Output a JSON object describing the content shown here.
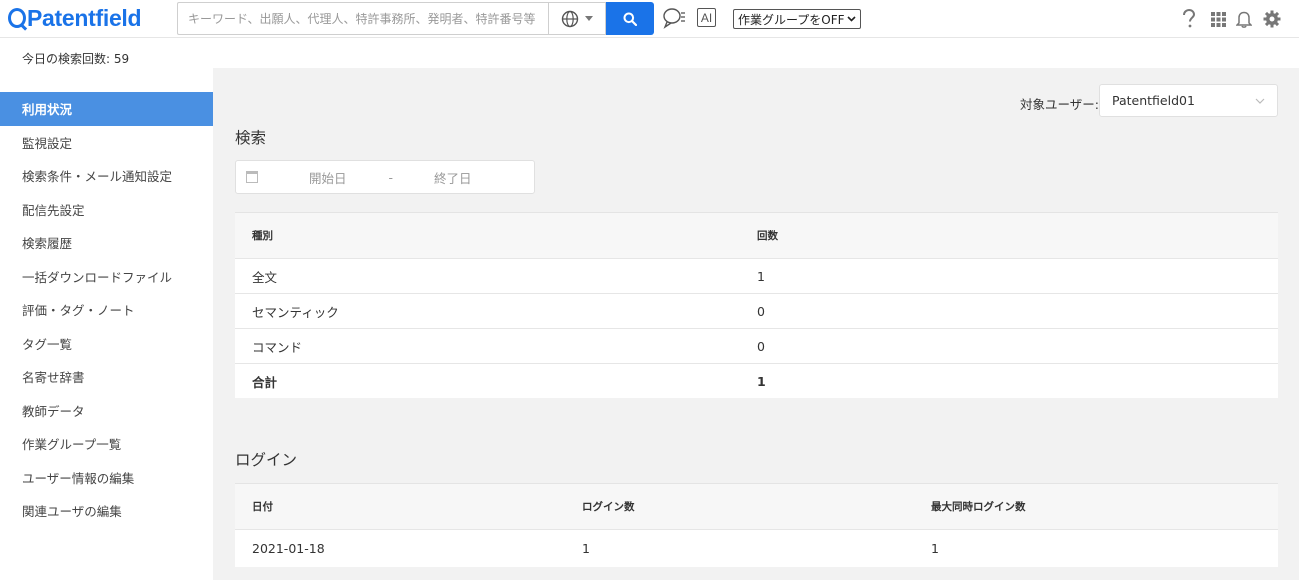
{
  "header": {
    "logo": "Patentfield",
    "search_placeholder": "キーワード、出願人、代理人、特許事務所、発明者、特許番号等",
    "work_group": "作業グループをOFF",
    "ai_label": "AI"
  },
  "sidebar": {
    "search_count": "今日の検索回数: 59",
    "items": [
      {
        "label": "利用状況",
        "active": true
      },
      {
        "label": "監視設定"
      },
      {
        "label": "検索条件・メール通知設定"
      },
      {
        "label": "配信先設定"
      },
      {
        "label": "検索履歴"
      },
      {
        "label": "一括ダウンロードファイル"
      },
      {
        "label": "評価・タグ・ノート"
      },
      {
        "label": "タグ一覧"
      },
      {
        "label": "名寄せ辞書"
      },
      {
        "label": "教師データ"
      },
      {
        "label": "作業グループ一覧"
      },
      {
        "label": "ユーザー情報の編集"
      },
      {
        "label": "関連ユーザの編集"
      }
    ]
  },
  "main": {
    "target_user_label": "対象ユーザー:",
    "target_user_value": "Patentfield01",
    "search_section": {
      "title": "検索",
      "date_start_placeholder": "開始日",
      "date_separator": "-",
      "date_end_placeholder": "終了日",
      "columns": [
        "種別",
        "回数"
      ],
      "rows": [
        [
          "全文",
          "1"
        ],
        [
          "セマンティック",
          "0"
        ],
        [
          "コマンド",
          "0"
        ]
      ],
      "total": [
        "合計",
        "1"
      ]
    },
    "login_section": {
      "title": "ログイン",
      "columns": [
        "日付",
        "ログイン数",
        "最大同時ログイン数"
      ],
      "rows": [
        [
          "2021-01-18",
          "1",
          "1"
        ]
      ]
    }
  },
  "colors": {
    "brand": "#1a73e8",
    "active_nav": "#4a90e2",
    "main_bg": "#f2f2f2"
  },
  "icons": [
    "globe-icon",
    "search-icon",
    "chat-icon",
    "ai-icon",
    "help-icon",
    "apps-grid-icon",
    "bell-icon",
    "gear-icon",
    "calendar-icon",
    "chevron-down-icon"
  ]
}
